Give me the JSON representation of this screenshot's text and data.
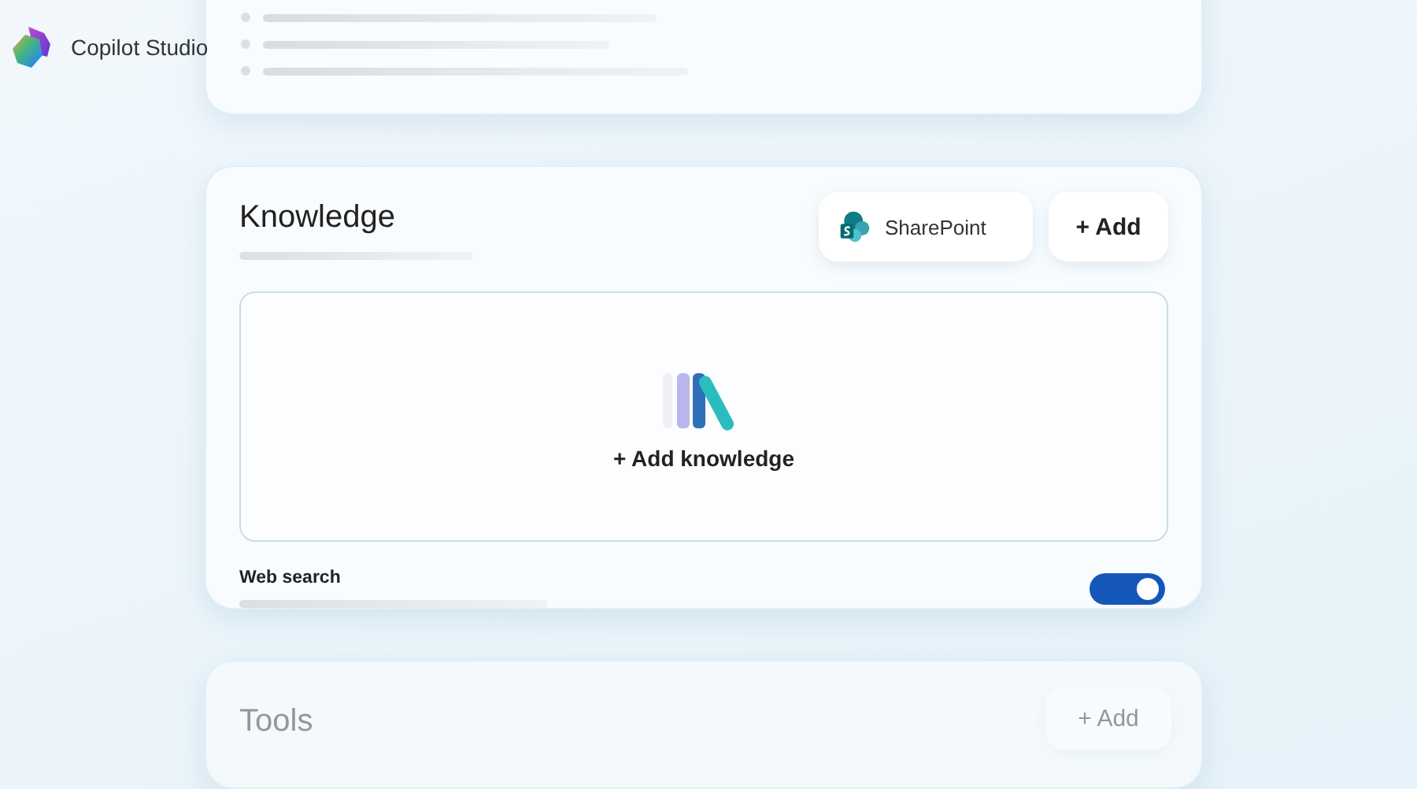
{
  "brand": {
    "name": "Copilot Studio"
  },
  "knowledge": {
    "title": "Knowledge",
    "source_button": "SharePoint",
    "add_button": "+ Add",
    "empty_action": "+ Add knowledge",
    "web_search": {
      "label": "Web search",
      "on": true
    }
  },
  "tools": {
    "title": "Tools",
    "add_button": "+ Add",
    "dimmed": true
  }
}
